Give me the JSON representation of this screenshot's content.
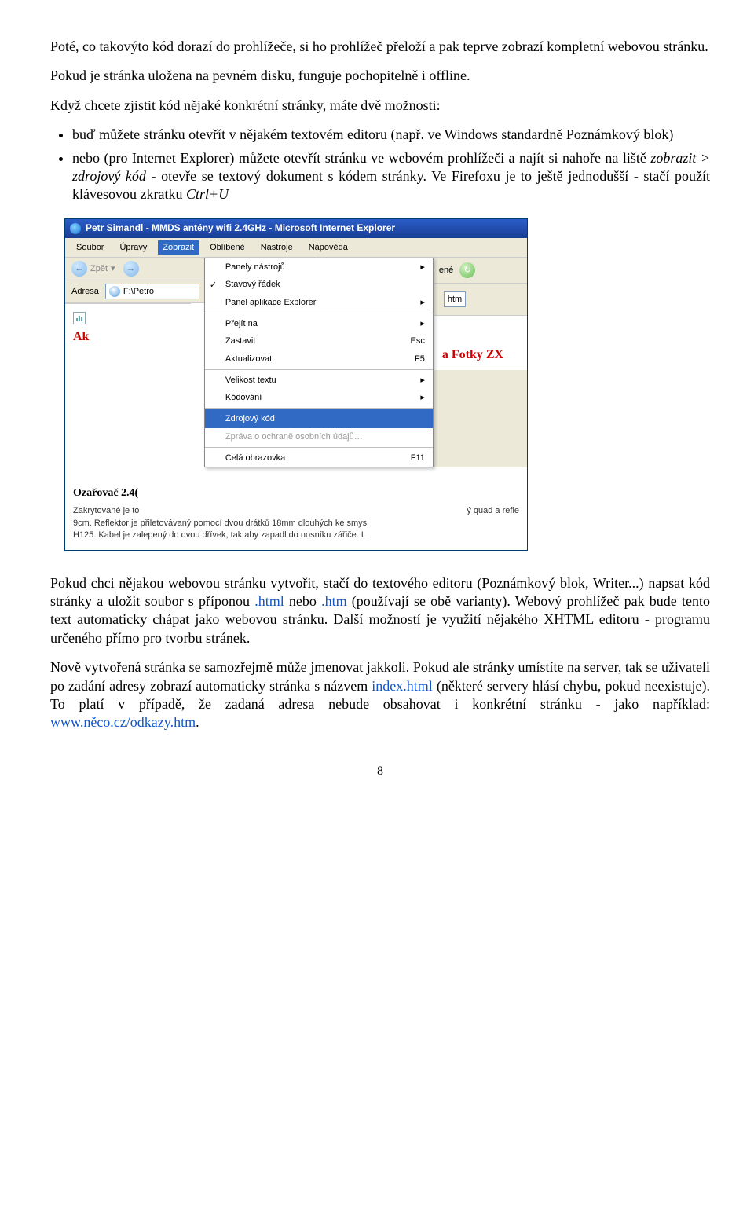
{
  "p1": "Poté, co takovýto kód dorazí do prohlížeče, si ho prohlížeč přeloží a pak teprve zobrazí kompletní webovou stránku.",
  "p2": "Pokud je stránka uložena na pevném disku, funguje pochopitelně i offline.",
  "p3": "Když chcete zjistit kód nějaké konkrétní stránky, máte dvě možnosti:",
  "li1a": "buď můžete stránku otevřít v nějakém textovém editoru (např. ve Windows standardně Poznámkový blok)",
  "li2a": "nebo (pro Internet Explorer) můžete otevřít stránku ve webovém prohlížeči a najít si nahoře na liště ",
  "li2b": "zobrazit > zdrojový kód",
  "li2c": " - otevře se textový dokument s kódem stránky. Ve Firefoxu je to ještě jednodušší - stačí použít klávesovou zkratku ",
  "li2d": "Ctrl+U",
  "ie": {
    "title": "Petr Simandl - MMDS antény wifi 2.4GHz - Microsoft Internet Explorer",
    "menu": {
      "soubor": "Soubor",
      "upravy": "Úpravy",
      "zobrazit": "Zobrazit",
      "oblibene": "Oblíbené",
      "nastroje": "Nástroje",
      "napoveda": "Nápověda"
    },
    "toolbar": {
      "zpet": "Zpět"
    },
    "addresslabel": "Adresa",
    "addresspath": "F:\\Petro",
    "right_ene": "ené",
    "right_addr": "htm",
    "dropdown": {
      "panely": "Panely nástrojů",
      "stav": "Stavový řádek",
      "panelapp": "Panel aplikace Explorer",
      "prejit": "Přejít na",
      "zastavit": "Zastavit",
      "aktual": "Aktualizovat",
      "esc": "Esc",
      "f5": "F5",
      "velikost": "Velikost textu",
      "kodovani": "Kódování",
      "zdroj": "Zdrojový kód",
      "zprava": "Zpráva o ochraně osobních údajů…",
      "cela": "Celá obrazovka",
      "f11": "F11"
    },
    "left_red": "Ak",
    "right_red": "a Fotky ZX",
    "subhead": "Ozařovač 2.4(",
    "body1": "Zakrytované je to",
    "body2": "ý quad a refle",
    "body3": "9cm. Reflektor je přiletovávaný pomocí dvou drátků 18mm dlouhých ke smys",
    "body4": "H125. Kabel je zalepený do dvou dřívek, tak aby zapadl do nosníku zářiče. L"
  },
  "p4a": "Pokud chci nějakou webovou stránku vytvořit, stačí do textového editoru (Poznámkový blok, Writer...) napsat kód stránky a uložit soubor s příponou ",
  "p4b": ".html",
  "p4c": " nebo ",
  "p4d": ".htm",
  "p4e": " (používají se obě varianty). Webový prohlížeč pak bude tento text automaticky chápat jako webovou stránku. Další možností je využití nějakého XHTML editoru - programu určeného přímo pro tvorbu stránek.",
  "p5a": "Nově vytvořená stránka se samozřejmě může jmenovat jakkoli. Pokud ale stránky umístíte na server, tak se uživateli po zadání adresy zobrazí automaticky stránka s názvem ",
  "p5b": "index.html",
  "p5c": " (některé servery hlásí chybu, pokud neexistuje). To platí v případě, že zadaná adresa nebude obsahovat i konkrétní stránku - jako například: ",
  "p5d": "www.něco.cz/odkazy.htm",
  "p5e": ".",
  "pagenum": "8"
}
